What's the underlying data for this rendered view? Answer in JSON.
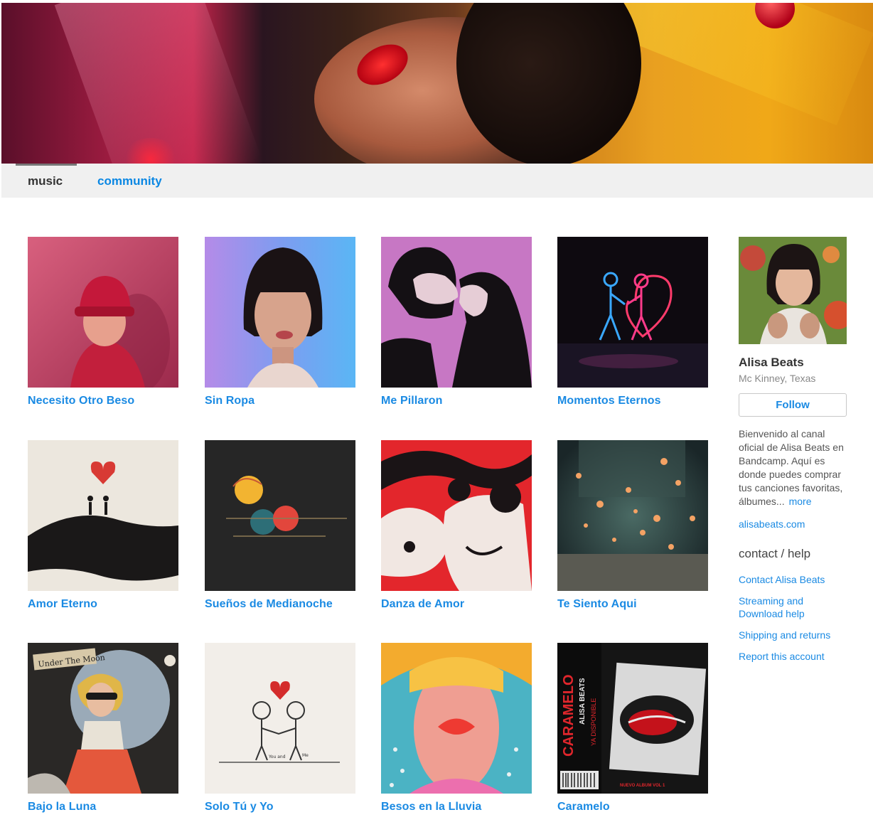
{
  "nav": {
    "music_label": "music",
    "community_label": "community"
  },
  "albums": [
    {
      "title": "Necesito Otro Beso",
      "icon": "red-hat-woman-art"
    },
    {
      "title": "Sin Ropa",
      "icon": "bob-hair-woman-art"
    },
    {
      "title": "Me Pillaron",
      "icon": "kissing-couple-art"
    },
    {
      "title": "Momentos Eternos",
      "icon": "neon-couple-heart-art"
    },
    {
      "title": "Amor Eterno",
      "icon": "couple-on-hill-heart-art"
    },
    {
      "title": "Sueños de Medianoche",
      "icon": "abstract-circles-art"
    },
    {
      "title": "Danza de Amor",
      "icon": "red-swirl-sunglasses-art"
    },
    {
      "title": "Te Siento Aqui",
      "icon": "glowing-hearts-art"
    },
    {
      "title": "Bajo la Luna",
      "icon": "collage-woman-moon-art"
    },
    {
      "title": "Solo Tú y Yo",
      "icon": "sketch-couple-heart-art"
    },
    {
      "title": "Besos en la Lluvia",
      "icon": "umbrella-lips-art"
    },
    {
      "title": "Caramelo",
      "icon": "caramelo-lips-cover-art"
    }
  ],
  "caramelo_cover": {
    "title_text": "CARAMELO",
    "artist_text": "ALISA BEATS",
    "sub_text": "YA DISPONIBLE",
    "footer_text": "NUEVO ALBUM VOL 1"
  },
  "bajo_cover": {
    "sign_text": "Under The Moon"
  },
  "solo_cover": {
    "label_you": "You and",
    "label_me": "Me"
  },
  "sidebar": {
    "band_name": "Alisa Beats",
    "location": "Mc Kinney, Texas",
    "follow_label": "Follow",
    "bio": "Bienvenido al canal oficial de Alisa Beats en Bandcamp. Aquí es donde puedes comprar tus canciones favoritas, álbumes...",
    "more_label": "more",
    "website": "alisabeats.com",
    "contact_heading": "contact / help",
    "links": [
      "Contact Alisa Beats",
      "Streaming and Download help",
      "Shipping and returns",
      "Report this account"
    ]
  },
  "colors": {
    "link": "#1a8ae3",
    "nav_bg": "#f0f0f0"
  }
}
